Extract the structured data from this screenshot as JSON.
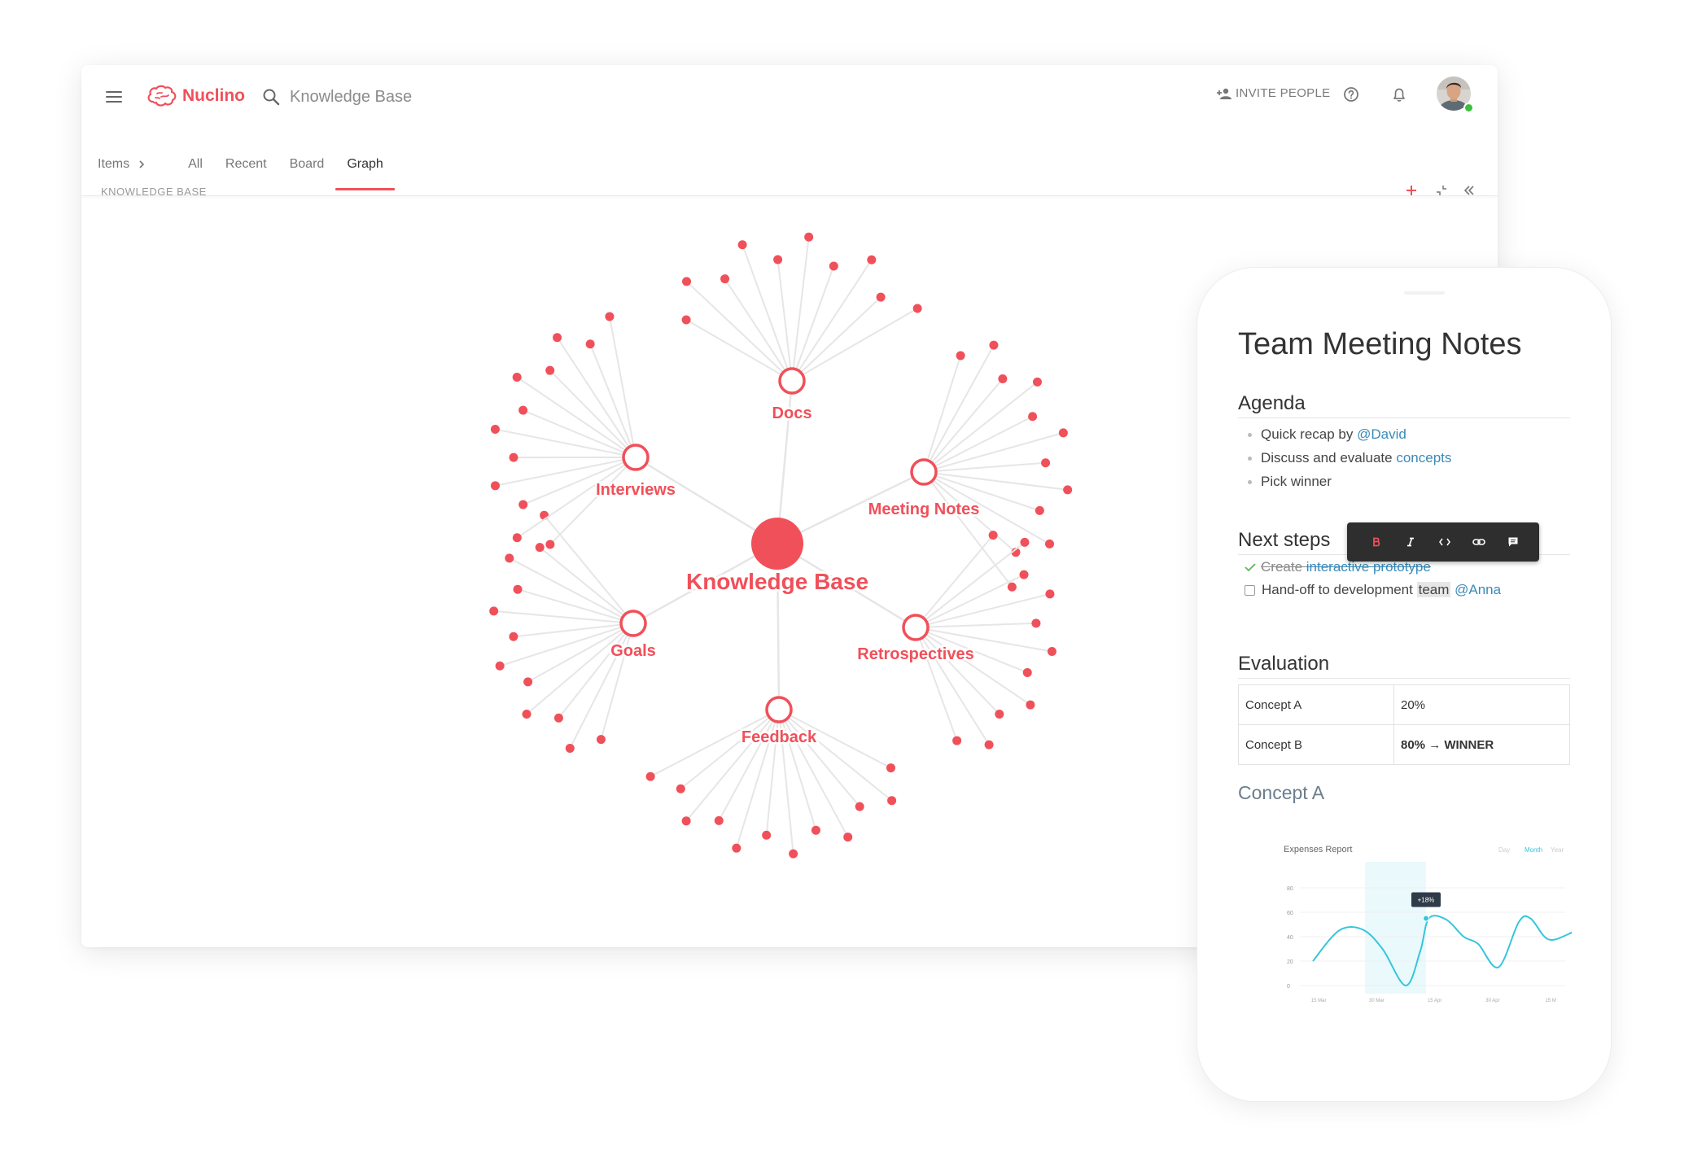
{
  "app": {
    "logo_text": "Nuclino",
    "search_text": "Knowledge Base",
    "invite_label": "INVITE PEOPLE",
    "icons": [
      "menu-icon",
      "logo-brain-icon",
      "search-icon",
      "add-person-icon",
      "help-icon",
      "bell-icon"
    ]
  },
  "tabs": {
    "items_label": "Items",
    "list": [
      "All",
      "Recent",
      "Board",
      "Graph"
    ],
    "active": "Graph"
  },
  "breadcrumb": "KNOWLEDGE BASE",
  "graph_tools": [
    "plus-icon",
    "collapse-icon",
    "double-chevron-left-icon"
  ],
  "graph": {
    "center_label": "Knowledge Base",
    "accent": "#f0505a",
    "edge_color": "#e6e6e6",
    "clusters": [
      {
        "label": "Docs",
        "leaves": 10
      },
      {
        "label": "Meeting Notes",
        "leaves": 12
      },
      {
        "label": "Retrospectives",
        "leaves": 11
      },
      {
        "label": "Feedback",
        "leaves": 12
      },
      {
        "label": "Goals",
        "leaves": 12
      },
      {
        "label": "Interviews",
        "leaves": 12
      }
    ]
  },
  "document": {
    "title": "Team Meeting Notes",
    "agenda_heading": "Agenda",
    "agenda": [
      {
        "text": "Quick recap by ",
        "link": "@David"
      },
      {
        "text": "Discuss and evaluate ",
        "link": "concepts"
      },
      {
        "text": "Pick winner",
        "link": ""
      }
    ],
    "next_steps_heading": "Next steps",
    "task_done_text": "Create ",
    "task_done_link": "interactive prototype",
    "task_open_text": "Hand-off to development ",
    "task_open_highlight": "team",
    "task_open_link": " @Anna",
    "format_toolbar": [
      "bold-icon",
      "italic-icon",
      "code-icon",
      "link-icon",
      "comment-icon"
    ],
    "evaluation_heading": "Evaluation",
    "evaluation_table": [
      [
        "Concept A",
        "20%"
      ],
      [
        "Concept B",
        "80% → WINNER"
      ]
    ],
    "concept_heading": "Concept A"
  },
  "chart_data": {
    "type": "line",
    "title": "Expenses Report",
    "range_options": [
      "Day",
      "Month",
      "Year"
    ],
    "selected_range": "Month",
    "tooltip": "+18%",
    "x_ticks": [
      "15 Mar",
      "30 Mar",
      "15 Apr",
      "30 Apr",
      "15 M"
    ],
    "y_ticks": [
      0,
      20,
      40,
      60,
      80
    ],
    "ylim": [
      0,
      80
    ],
    "line_color": "#35c6dc",
    "series": [
      {
        "points": [
          [
            0,
            20
          ],
          [
            0.45,
            45
          ],
          [
            0.85,
            46
          ],
          [
            1.2,
            30
          ],
          [
            1.6,
            0
          ],
          [
            1.85,
            28
          ],
          [
            2.0,
            55
          ],
          [
            2.3,
            54
          ],
          [
            2.6,
            40
          ],
          [
            2.85,
            34
          ],
          [
            3.2,
            15
          ],
          [
            3.55,
            52
          ],
          [
            3.75,
            55
          ],
          [
            4.05,
            38
          ],
          [
            4.4,
            42
          ],
          [
            4.75,
            52
          ]
        ]
      }
    ],
    "highlight_x_range": [
      0.9,
      1.95
    ],
    "highlight_point": [
      1.95,
      55
    ]
  }
}
